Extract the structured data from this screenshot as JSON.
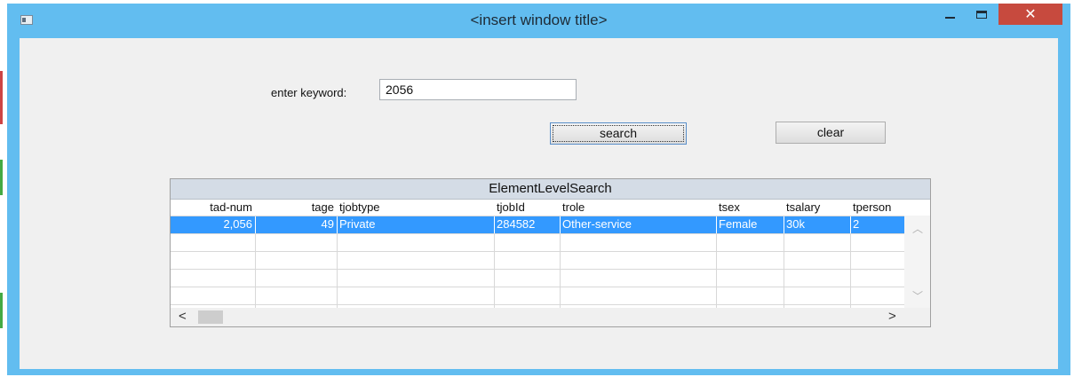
{
  "window": {
    "title": "<insert window title>",
    "close_glyph": "✕"
  },
  "form": {
    "keyword_label": "enter keyword:",
    "keyword_value": "2056",
    "search_label": "search",
    "clear_label": "clear"
  },
  "grid": {
    "title": "ElementLevelSearch",
    "columns": [
      "tad-num",
      "tage",
      "tjobtype",
      "tjobId",
      "trole",
      "tsex",
      "tsalary",
      "tperson"
    ],
    "rows": [
      [
        "2,056",
        "49",
        "Private",
        "284582",
        "Other-service",
        "Female",
        "30k",
        "2"
      ]
    ],
    "selected_row": 0
  },
  "icons": {
    "app": "app-window-icon",
    "minimize": "minimize-icon",
    "maximize": "maximize-icon",
    "close": "close-icon",
    "scroll_up": "chevron-up-icon",
    "scroll_down": "chevron-down-icon",
    "scroll_left": "chevron-left-icon",
    "scroll_right": "chevron-right-icon"
  },
  "colors": {
    "titlebar": "#62bdf0",
    "selection": "#3399ff",
    "close_button": "#c74a3e"
  }
}
